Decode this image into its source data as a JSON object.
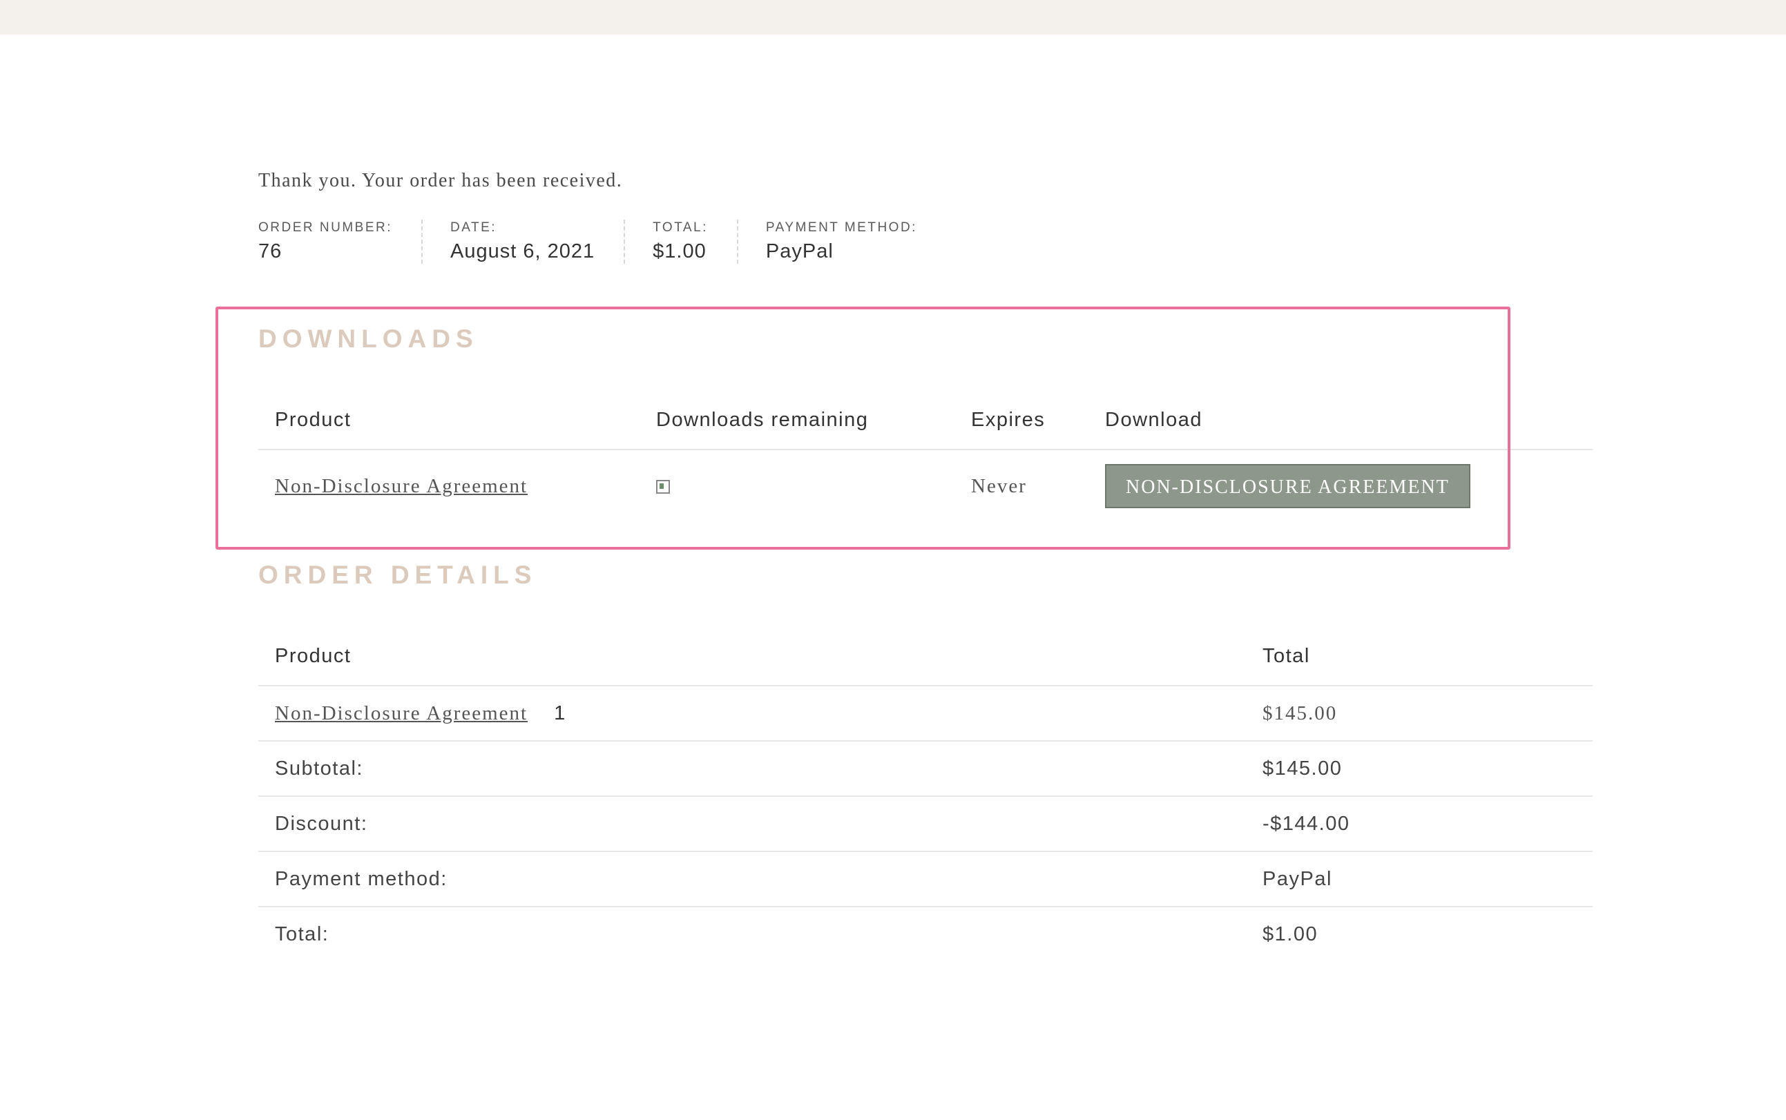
{
  "thanks_message": "Thank you. Your order has been received.",
  "overview": [
    {
      "label": "ORDER NUMBER:",
      "value": "76"
    },
    {
      "label": "DATE:",
      "value": "August 6, 2021"
    },
    {
      "label": "TOTAL:",
      "value": "$1.00"
    },
    {
      "label": "PAYMENT METHOD:",
      "value": "PayPal"
    }
  ],
  "downloads": {
    "title": "DOWNLOADS",
    "headers": {
      "product": "Product",
      "remaining": "Downloads remaining",
      "expires": "Expires",
      "download": "Download"
    },
    "row": {
      "product": "Non-Disclosure Agreement",
      "remaining_icon": "broken-image-icon",
      "expires": "Never",
      "button": "NON-DISCLOSURE AGREEMENT"
    }
  },
  "order_details": {
    "title": "ORDER DETAILS",
    "headers": {
      "product": "Product",
      "total": "Total"
    },
    "item": {
      "product": "Non-Disclosure Agreement",
      "quantity": "1",
      "total": "$145.00"
    },
    "subtotal": {
      "label": "Subtotal:",
      "value": "$145.00"
    },
    "discount": {
      "label": "Discount:",
      "value": "-$144.00"
    },
    "payment": {
      "label": "Payment method:",
      "value": "PayPal"
    },
    "total": {
      "label": "Total:",
      "value": "$1.00"
    }
  },
  "colors": {
    "accent_title": "#dccbbc",
    "button_bg": "#8e978b",
    "highlight_border": "#e8709a"
  }
}
